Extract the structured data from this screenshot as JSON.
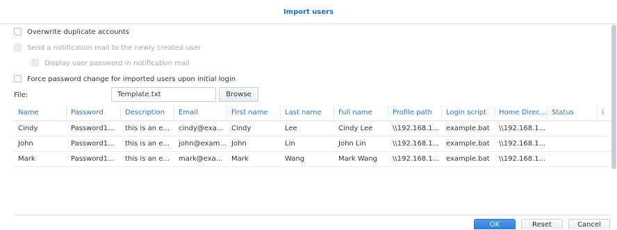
{
  "dialog": {
    "title": "Import users"
  },
  "options": [
    {
      "label": "Overwrite duplicate accounts",
      "checked": false,
      "disabled": false
    },
    {
      "label": "Send a notification mail to the newly created user",
      "checked": false,
      "disabled": true
    },
    {
      "label": "Display user password in notification mail",
      "checked": false,
      "disabled": true
    },
    {
      "label": "Force password change for imported users upon initial login",
      "checked": false,
      "disabled": false
    }
  ],
  "file": {
    "label": "File:",
    "value": "Template.txt",
    "browse_label": "Browse"
  },
  "table": {
    "columns": [
      "Name",
      "Password",
      "Description",
      "Email",
      "First name",
      "Last name",
      "Full name",
      "Profile path",
      "Login script",
      "Home Direc...",
      "Status",
      "⁞"
    ],
    "rows": [
      [
        "Cindy",
        "Password1...",
        "this is an e...",
        "cindy@exa...",
        "Cindy",
        "Lee",
        "Cindy Lee",
        "\\\\192.168.1...",
        "example.bat",
        "\\\\192.168.1...",
        ""
      ],
      [
        "John",
        "Password1...",
        "this is an e...",
        "john@exam...",
        "John",
        "Lin",
        "John Lin",
        "\\\\192.168.1...",
        "example.bat",
        "\\\\192.168.1...",
        ""
      ],
      [
        "Mark",
        "Password1...",
        "this is an e...",
        "mark@exa...",
        "Mark",
        "Wang",
        "Mark Wang",
        "\\\\192.168.1...",
        "example.bat",
        "\\\\192.168.1...",
        ""
      ]
    ]
  },
  "footer": {
    "ok_label": "OK",
    "reset_label": "Reset",
    "cancel_label": "Cancel"
  },
  "colors": {
    "accent": "#1a6fc9",
    "header_text": "#3173c4",
    "primary_button": "#2f7fd8"
  }
}
